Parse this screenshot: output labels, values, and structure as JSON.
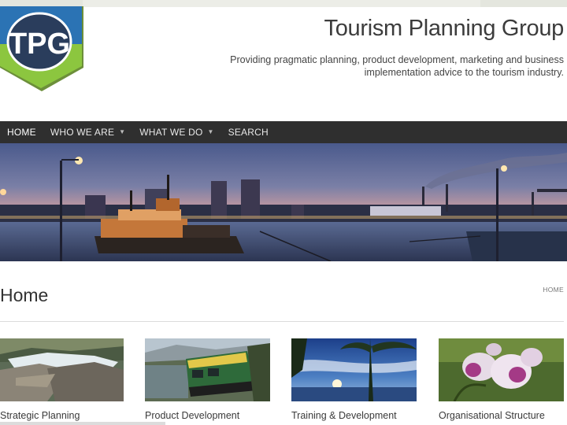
{
  "header": {
    "logo_text": "TPG",
    "site_title": "Tourism Planning Group",
    "tagline": "Providing pragmatic planning, product development, marketing and business implementation advice to the tourism industry."
  },
  "nav": {
    "items": [
      {
        "label": "HOME",
        "has_dropdown": false
      },
      {
        "label": "WHO WE ARE",
        "has_dropdown": true
      },
      {
        "label": "WHAT WE DO",
        "has_dropdown": true
      },
      {
        "label": "SEARCH",
        "has_dropdown": false
      }
    ],
    "caret": "▼"
  },
  "page": {
    "title": "Home",
    "breadcrumb": "HOME"
  },
  "cards": [
    {
      "caption": "Strategic Planning",
      "image": "waterfall-rocks-photo"
    },
    {
      "caption": "Product Development",
      "image": "green-train-photo"
    },
    {
      "caption": "Training & Development",
      "image": "palm-sunset-photo"
    },
    {
      "caption": "Organisational Structure",
      "image": "orchid-flower-photo"
    }
  ],
  "colors": {
    "nav_bg": "#2f2f2f",
    "logo_blue": "#2b73b4",
    "logo_green": "#8cc63f",
    "logo_dark": "#2a3d5c"
  }
}
